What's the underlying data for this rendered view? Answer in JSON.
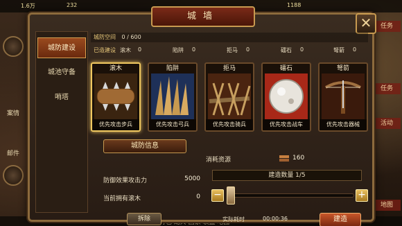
{
  "hud": {
    "top_resources": [
      "1.6万",
      "232",
      "1188"
    ],
    "left_labels": [
      "案情",
      "邮件"
    ],
    "right_chips": [
      "任务",
      "任务",
      "活动",
      "地图"
    ],
    "bottom_text": "城防值 背包 配兵 国家 联盟 地图"
  },
  "panel": {
    "title": "城墙",
    "close_label": "✕"
  },
  "sidebar": {
    "tabs": [
      {
        "label": "城防建设",
        "active": true
      },
      {
        "label": "城池守备",
        "active": false
      },
      {
        "label": "哨塔",
        "active": false
      }
    ]
  },
  "capacity": {
    "label": "城防空间",
    "value": "0 / 600"
  },
  "built": {
    "label": "已造建设",
    "items": [
      {
        "name": "滚木",
        "count": "0"
      },
      {
        "name": "陷阱",
        "count": "0"
      },
      {
        "name": "拒马",
        "count": "0"
      },
      {
        "name": "礌石",
        "count": "0"
      },
      {
        "name": "弩箭",
        "count": "0"
      }
    ]
  },
  "cards": [
    {
      "title": "滚木",
      "caption": "优先攻击步兵",
      "selected": true,
      "theme": "log",
      "color": "#8a5a2a"
    },
    {
      "title": "陷阱",
      "caption": "优先攻击弓兵",
      "selected": false,
      "theme": "trap",
      "color": "#2a4a7a"
    },
    {
      "title": "拒马",
      "caption": "优先攻击骑兵",
      "selected": false,
      "theme": "barricade",
      "color": "#7a3a1a"
    },
    {
      "title": "礌石",
      "caption": "优先攻击战车",
      "selected": false,
      "theme": "stone",
      "color": "#a02a1a"
    },
    {
      "title": "弩箭",
      "caption": "优先攻击器械",
      "selected": false,
      "theme": "crossbow",
      "color": "#5a2a1a"
    }
  ],
  "info": {
    "header": "城防信息",
    "rows": [
      {
        "label": "防御效果攻击力",
        "value": "5000"
      },
      {
        "label": "当前拥有滚木",
        "value": "0"
      }
    ],
    "dismantle_label": "拆除"
  },
  "build": {
    "resource_label": "消耗资源",
    "resource_value": "160",
    "count_text": "建造数量 1/5",
    "slider_value": 1,
    "slider_max": 5,
    "minus_label": "−",
    "plus_label": "+",
    "time_label": "实际耗时",
    "time_value": "00:00:36",
    "build_label": "建造"
  },
  "colors": {
    "accent_gold": "#c89a50",
    "panel_bg": "#2e2218",
    "build_button": "#c8562a"
  }
}
